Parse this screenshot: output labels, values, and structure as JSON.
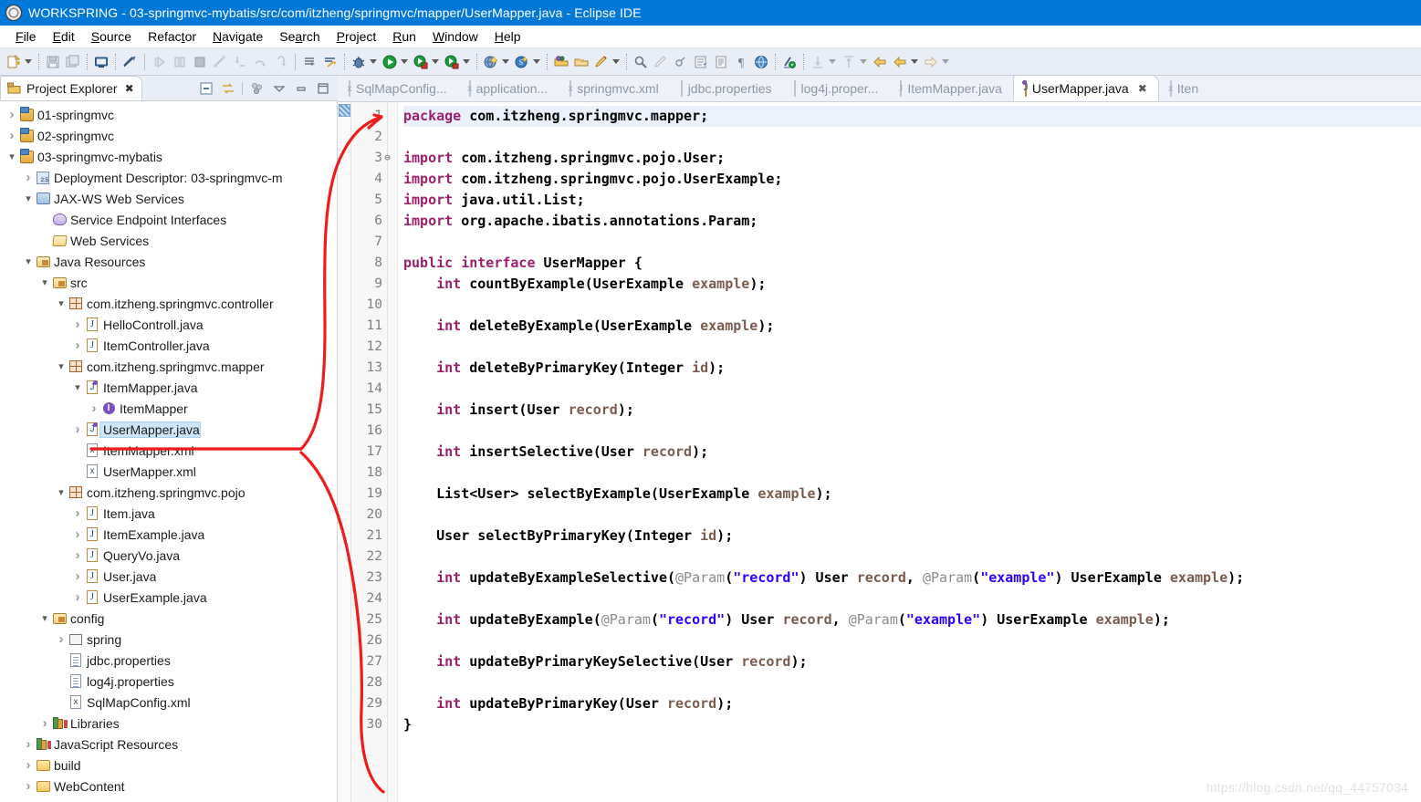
{
  "window": {
    "title": "WORKSPRING - 03-springmvc-mybatis/src/com/itzheng/springmvc/mapper/UserMapper.java - Eclipse IDE",
    "app_icon": "eclipse-icon"
  },
  "menubar": {
    "items": [
      {
        "label": "File",
        "mnemonic": "F"
      },
      {
        "label": "Edit",
        "mnemonic": "E"
      },
      {
        "label": "Source",
        "mnemonic": "S"
      },
      {
        "label": "Refactor",
        "mnemonic": "t"
      },
      {
        "label": "Navigate",
        "mnemonic": "N"
      },
      {
        "label": "Search",
        "mnemonic": "a"
      },
      {
        "label": "Project",
        "mnemonic": "P"
      },
      {
        "label": "Run",
        "mnemonic": "R"
      },
      {
        "label": "Window",
        "mnemonic": "W"
      },
      {
        "label": "Help",
        "mnemonic": "H"
      }
    ]
  },
  "toolbar": {
    "groups": [
      [
        "new-wizard-icon",
        "dropdown-caret"
      ],
      [
        "save-icon",
        "save-all-icon"
      ],
      [
        "console-icon"
      ],
      [
        "toggle-markoccurrences-icon"
      ],
      [
        "resume-icon",
        "suspend-icon",
        "terminate-icon",
        "disconnect-icon",
        "step-into-icon",
        "step-over-icon",
        "step-return-icon"
      ],
      [
        "skip-breakpoints-icon",
        "next-annotation-icon"
      ],
      [
        "debug-icon",
        "dropdown-caret"
      ],
      [
        "run-icon",
        "dropdown-caret"
      ],
      [
        "run-external-tools-icon",
        "dropdown-caret"
      ],
      [
        "run-server-icon",
        "dropdown-caret"
      ],
      [
        "new-java-project-icon",
        "dropdown-caret"
      ],
      [
        "new-package-icon",
        "dropdown-caret"
      ],
      [
        "open-type-icon",
        "open-task-icon",
        "edit-icon",
        "dropdown-caret"
      ],
      [
        "search-icon",
        "pencil-icon",
        "link-icon",
        "outline-icon",
        "properties-icon",
        "pilcrow-icon",
        "web-browser-icon"
      ],
      [
        "run-on-server-icon"
      ],
      [
        "previous-edit-icon",
        "dropdown-caret"
      ],
      [
        "next-member-icon",
        "dropdown-caret"
      ],
      [
        "back-icon",
        "back-history-icon",
        "dropdown-caret"
      ],
      [
        "forward-icon",
        "dropdown-caret"
      ]
    ]
  },
  "explorer": {
    "tab_label": "Project Explorer",
    "tab_icon": "project-explorer-icon",
    "close_glyph": "✖",
    "view_buttons": [
      "collapse-all-icon",
      "link-with-editor-icon",
      "view-menu-filter-icon",
      "view-menu-icon",
      "minimize-icon",
      "maximize-icon"
    ],
    "tree": [
      {
        "label": "01-springmvc",
        "indent": 0,
        "arrow": "closed",
        "icon": "project-icon"
      },
      {
        "label": "02-springmvc",
        "indent": 0,
        "arrow": "closed",
        "icon": "project-icon"
      },
      {
        "label": "03-springmvc-mybatis",
        "indent": 0,
        "arrow": "open",
        "icon": "project-icon"
      },
      {
        "label": "Deployment Descriptor: 03-springmvc-m",
        "indent": 1,
        "arrow": "closed",
        "icon": "deployment-descriptor-icon"
      },
      {
        "label": "JAX-WS Web Services",
        "indent": 1,
        "arrow": "open",
        "icon": "webservices-icon"
      },
      {
        "label": "Service Endpoint Interfaces",
        "indent": 2,
        "arrow": "none",
        "icon": "service-endpoint-icon"
      },
      {
        "label": "Web Services",
        "indent": 2,
        "arrow": "none",
        "icon": "web-service-icon"
      },
      {
        "label": "Java Resources",
        "indent": 1,
        "arrow": "open",
        "icon": "java-resources-icon"
      },
      {
        "label": "src",
        "indent": 2,
        "arrow": "open",
        "icon": "source-folder-icon"
      },
      {
        "label": "com.itzheng.springmvc.controller",
        "indent": 3,
        "arrow": "open",
        "icon": "package-icon"
      },
      {
        "label": "HelloControll.java",
        "indent": 4,
        "arrow": "closed",
        "icon": "java-file-icon"
      },
      {
        "label": "ItemController.java",
        "indent": 4,
        "arrow": "closed",
        "icon": "java-file-icon"
      },
      {
        "label": "com.itzheng.springmvc.mapper",
        "indent": 3,
        "arrow": "open",
        "icon": "package-icon"
      },
      {
        "label": "ItemMapper.java",
        "indent": 4,
        "arrow": "open",
        "icon": "java-interface-file-icon"
      },
      {
        "label": "ItemMapper",
        "indent": 5,
        "arrow": "closed",
        "icon": "interface-icon"
      },
      {
        "label": "UserMapper.java",
        "indent": 4,
        "arrow": "closed",
        "icon": "java-interface-file-icon",
        "selected": true
      },
      {
        "label": "ItemMapper.xml",
        "indent": 4,
        "arrow": "none",
        "icon": "xml-file-icon"
      },
      {
        "label": "UserMapper.xml",
        "indent": 4,
        "arrow": "none",
        "icon": "xml-file-icon"
      },
      {
        "label": "com.itzheng.springmvc.pojo",
        "indent": 3,
        "arrow": "open",
        "icon": "package-icon"
      },
      {
        "label": "Item.java",
        "indent": 4,
        "arrow": "closed",
        "icon": "java-file-icon"
      },
      {
        "label": "ItemExample.java",
        "indent": 4,
        "arrow": "closed",
        "icon": "java-file-icon"
      },
      {
        "label": "QueryVo.java",
        "indent": 4,
        "arrow": "closed",
        "icon": "java-file-icon"
      },
      {
        "label": "User.java",
        "indent": 4,
        "arrow": "closed",
        "icon": "java-file-icon"
      },
      {
        "label": "UserExample.java",
        "indent": 4,
        "arrow": "closed",
        "icon": "java-file-icon"
      },
      {
        "label": "config",
        "indent": 2,
        "arrow": "open",
        "icon": "source-folder-icon"
      },
      {
        "label": "spring",
        "indent": 3,
        "arrow": "closed",
        "icon": "spring-folder-icon"
      },
      {
        "label": "jdbc.properties",
        "indent": 3,
        "arrow": "none",
        "icon": "properties-file-icon"
      },
      {
        "label": "log4j.properties",
        "indent": 3,
        "arrow": "none",
        "icon": "properties-file-icon"
      },
      {
        "label": "SqlMapConfig.xml",
        "indent": 3,
        "arrow": "none",
        "icon": "xml-file-icon"
      },
      {
        "label": "Libraries",
        "indent": 2,
        "arrow": "closed",
        "icon": "libraries-icon"
      },
      {
        "label": "JavaScript Resources",
        "indent": 1,
        "arrow": "closed",
        "icon": "libraries-icon"
      },
      {
        "label": "build",
        "indent": 1,
        "arrow": "closed",
        "icon": "folder-icon"
      },
      {
        "label": "WebContent",
        "indent": 1,
        "arrow": "closed",
        "icon": "folder-icon"
      }
    ]
  },
  "editor": {
    "tabs": [
      {
        "label": "SqlMapConfig...",
        "icon": "xml-file-icon",
        "active": false
      },
      {
        "label": "application...",
        "icon": "xml-file-icon",
        "active": false
      },
      {
        "label": "springmvc.xml",
        "icon": "xml-file-icon",
        "active": false
      },
      {
        "label": "jdbc.properties",
        "icon": "properties-file-icon",
        "active": false
      },
      {
        "label": "log4j.proper...",
        "icon": "properties-file-icon",
        "active": false
      },
      {
        "label": "ItemMapper.java",
        "icon": "java-file-icon",
        "active": false
      },
      {
        "label": "UserMapper.java",
        "icon": "java-interface-file-icon",
        "active": true,
        "close_glyph": "✖"
      },
      {
        "label": "Iten",
        "icon": "xml-file-icon",
        "active": false
      }
    ],
    "first_line": 1,
    "last_line": 30,
    "current_line": 1,
    "fold_marker_line": 3,
    "lines": [
      {
        "n": 1,
        "cur": true,
        "tokens": [
          {
            "t": "package ",
            "c": "kw"
          },
          {
            "t": "com.itzheng.springmvc.mapper;",
            "c": "plain"
          }
        ]
      },
      {
        "n": 2,
        "tokens": []
      },
      {
        "n": 3,
        "fold": true,
        "tokens": [
          {
            "t": "import ",
            "c": "kw"
          },
          {
            "t": "com.itzheng.springmvc.pojo.User;",
            "c": "plain"
          }
        ]
      },
      {
        "n": 4,
        "tokens": [
          {
            "t": "import ",
            "c": "kw"
          },
          {
            "t": "com.itzheng.springmvc.pojo.UserExample;",
            "c": "plain"
          }
        ]
      },
      {
        "n": 5,
        "tokens": [
          {
            "t": "import ",
            "c": "kw"
          },
          {
            "t": "java.util.List;",
            "c": "plain"
          }
        ]
      },
      {
        "n": 6,
        "tokens": [
          {
            "t": "import ",
            "c": "kw"
          },
          {
            "t": "org.apache.ibatis.annotations.Param;",
            "c": "plain"
          }
        ]
      },
      {
        "n": 7,
        "tokens": []
      },
      {
        "n": 8,
        "tokens": [
          {
            "t": "public interface ",
            "c": "kw"
          },
          {
            "t": "UserMapper {",
            "c": "plain"
          }
        ]
      },
      {
        "n": 9,
        "tokens": [
          {
            "t": "    ",
            "c": "plain"
          },
          {
            "t": "int",
            "c": "kw"
          },
          {
            "t": " countByExample(UserExample ",
            "c": "plain"
          },
          {
            "t": "example",
            "c": "param"
          },
          {
            "t": ");",
            "c": "plain"
          }
        ]
      },
      {
        "n": 10,
        "tokens": []
      },
      {
        "n": 11,
        "tokens": [
          {
            "t": "    ",
            "c": "plain"
          },
          {
            "t": "int",
            "c": "kw"
          },
          {
            "t": " deleteByExample(UserExample ",
            "c": "plain"
          },
          {
            "t": "example",
            "c": "param"
          },
          {
            "t": ");",
            "c": "plain"
          }
        ]
      },
      {
        "n": 12,
        "tokens": []
      },
      {
        "n": 13,
        "tokens": [
          {
            "t": "    ",
            "c": "plain"
          },
          {
            "t": "int",
            "c": "kw"
          },
          {
            "t": " deleteByPrimaryKey(Integer ",
            "c": "plain"
          },
          {
            "t": "id",
            "c": "param"
          },
          {
            "t": ");",
            "c": "plain"
          }
        ]
      },
      {
        "n": 14,
        "tokens": []
      },
      {
        "n": 15,
        "tokens": [
          {
            "t": "    ",
            "c": "plain"
          },
          {
            "t": "int",
            "c": "kw"
          },
          {
            "t": " insert(User ",
            "c": "plain"
          },
          {
            "t": "record",
            "c": "param"
          },
          {
            "t": ");",
            "c": "plain"
          }
        ]
      },
      {
        "n": 16,
        "tokens": []
      },
      {
        "n": 17,
        "tokens": [
          {
            "t": "    ",
            "c": "plain"
          },
          {
            "t": "int",
            "c": "kw"
          },
          {
            "t": " insertSelective(User ",
            "c": "plain"
          },
          {
            "t": "record",
            "c": "param"
          },
          {
            "t": ");",
            "c": "plain"
          }
        ]
      },
      {
        "n": 18,
        "tokens": []
      },
      {
        "n": 19,
        "tokens": [
          {
            "t": "    List<User> selectByExample(UserExample ",
            "c": "plain"
          },
          {
            "t": "example",
            "c": "param"
          },
          {
            "t": ");",
            "c": "plain"
          }
        ]
      },
      {
        "n": 20,
        "tokens": []
      },
      {
        "n": 21,
        "tokens": [
          {
            "t": "    User selectByPrimaryKey(Integer ",
            "c": "plain"
          },
          {
            "t": "id",
            "c": "param"
          },
          {
            "t": ");",
            "c": "plain"
          }
        ]
      },
      {
        "n": 22,
        "tokens": []
      },
      {
        "n": 23,
        "tokens": [
          {
            "t": "    ",
            "c": "plain"
          },
          {
            "t": "int",
            "c": "kw"
          },
          {
            "t": " updateByExampleSelective(",
            "c": "plain"
          },
          {
            "t": "@Param",
            "c": "anno"
          },
          {
            "t": "(",
            "c": "plain"
          },
          {
            "t": "\"record\"",
            "c": "str"
          },
          {
            "t": ") User ",
            "c": "plain"
          },
          {
            "t": "record",
            "c": "param"
          },
          {
            "t": ", ",
            "c": "plain"
          },
          {
            "t": "@Param",
            "c": "anno"
          },
          {
            "t": "(",
            "c": "plain"
          },
          {
            "t": "\"example\"",
            "c": "str"
          },
          {
            "t": ") UserExample ",
            "c": "plain"
          },
          {
            "t": "example",
            "c": "param"
          },
          {
            "t": ");",
            "c": "plain"
          }
        ]
      },
      {
        "n": 24,
        "tokens": []
      },
      {
        "n": 25,
        "tokens": [
          {
            "t": "    ",
            "c": "plain"
          },
          {
            "t": "int",
            "c": "kw"
          },
          {
            "t": " updateByExample(",
            "c": "plain"
          },
          {
            "t": "@Param",
            "c": "anno"
          },
          {
            "t": "(",
            "c": "plain"
          },
          {
            "t": "\"record\"",
            "c": "str"
          },
          {
            "t": ") User ",
            "c": "plain"
          },
          {
            "t": "record",
            "c": "param"
          },
          {
            "t": ", ",
            "c": "plain"
          },
          {
            "t": "@Param",
            "c": "anno"
          },
          {
            "t": "(",
            "c": "plain"
          },
          {
            "t": "\"example\"",
            "c": "str"
          },
          {
            "t": ") UserExample ",
            "c": "plain"
          },
          {
            "t": "example",
            "c": "param"
          },
          {
            "t": ");",
            "c": "plain"
          }
        ]
      },
      {
        "n": 26,
        "tokens": []
      },
      {
        "n": 27,
        "tokens": [
          {
            "t": "    ",
            "c": "plain"
          },
          {
            "t": "int",
            "c": "kw"
          },
          {
            "t": " updateByPrimaryKeySelective(User ",
            "c": "plain"
          },
          {
            "t": "record",
            "c": "param"
          },
          {
            "t": ");",
            "c": "plain"
          }
        ]
      },
      {
        "n": 28,
        "tokens": []
      },
      {
        "n": 29,
        "tokens": [
          {
            "t": "    ",
            "c": "plain"
          },
          {
            "t": "int",
            "c": "kw"
          },
          {
            "t": " updateByPrimaryKey(User ",
            "c": "plain"
          },
          {
            "t": "record",
            "c": "param"
          },
          {
            "t": ");",
            "c": "plain"
          }
        ]
      },
      {
        "n": 30,
        "tokens": [
          {
            "t": "}",
            "c": "plain"
          }
        ]
      }
    ]
  },
  "annotation": {
    "color": "#ee1c1c",
    "description": "hand-drawn red curve linking UserMapper.java in the tree to the editor"
  },
  "watermark": {
    "text": "https://blog.csdn.net/qq_44757034"
  },
  "colors": {
    "title_bar": "#0078d7",
    "toolbar_bg": "#e9edf5",
    "selection": "#cde6f7",
    "keyword": "#9b1f6b",
    "string": "#2a00ff",
    "param": "#7a5c4e",
    "annotation_gray": "#8a8a8a",
    "current_line": "#eaf1fb",
    "red_ink": "#ee1c1c"
  }
}
